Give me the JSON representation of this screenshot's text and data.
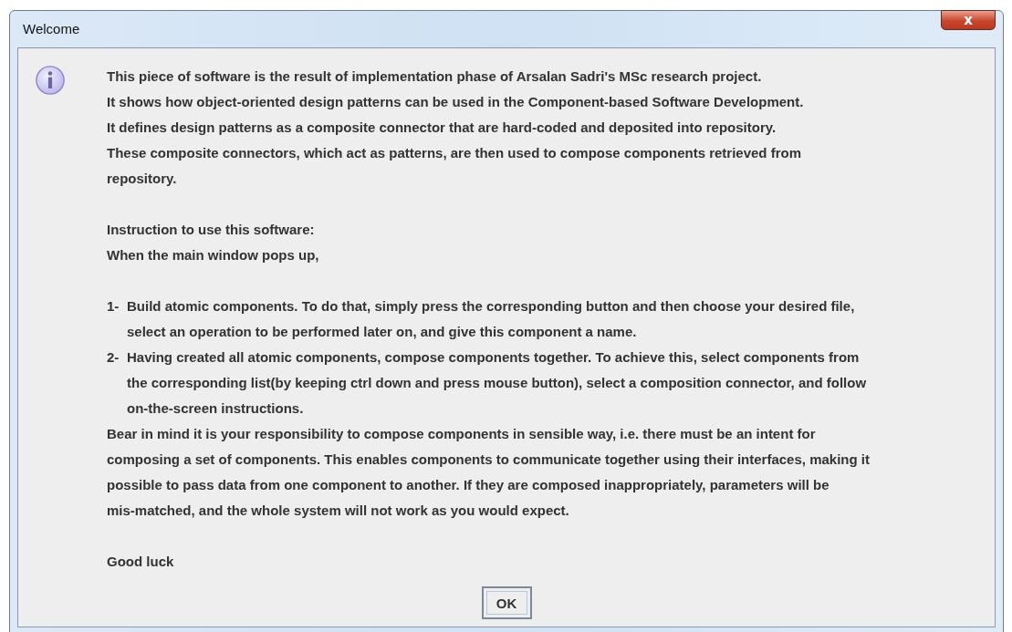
{
  "window": {
    "title": "Welcome",
    "close_label": "x"
  },
  "message": [
    {
      "kind": "text",
      "lines": [
        "This piece of software is the result of implementation phase of Arsalan Sadri's MSc research project.",
        "It shows how object-oriented design patterns can be used in the Component-based Software Development.",
        "It defines design patterns as a composite connector that are hard-coded and deposited into repository.",
        "These composite connectors, which act as patterns, are then used to compose components retrieved from",
        "repository."
      ]
    },
    {
      "kind": "text",
      "lines": [
        "Instruction to use this software:",
        "When the main window pops up,"
      ]
    },
    {
      "kind": "step",
      "number": "1-",
      "lines": [
        "Build atomic components. To do that, simply press the corresponding button and then choose your desired file,",
        "select an operation to be performed later on, and give this component a name."
      ]
    },
    {
      "kind": "step",
      "number": "2-",
      "lines": [
        "Having created all atomic components, compose components together. To achieve this, select components from",
        "the corresponding list(by keeping ctrl down and press mouse button), select a composition connector, and follow",
        "on-the-screen instructions."
      ]
    },
    {
      "kind": "text",
      "lines": [
        "Bear in mind it is your responsibility to compose components in sensible way, i.e. there must be an intent for",
        "composing a set of components. This enables components to communicate together using their interfaces, making it",
        "possible to pass data from one component to another. If they are composed inappropriately, parameters will be",
        "mis-matched, and the whole system will not work as you would expect."
      ]
    },
    {
      "kind": "text",
      "lines": [
        "Good luck"
      ]
    }
  ],
  "buttons": [
    "OK"
  ]
}
